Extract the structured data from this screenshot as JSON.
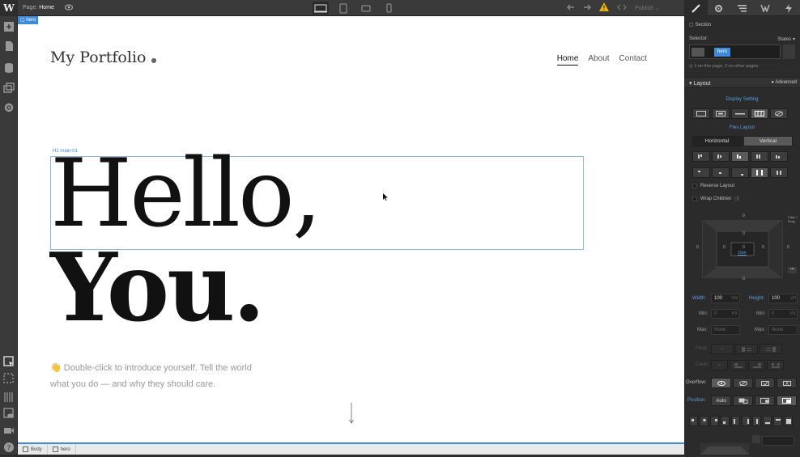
{
  "topbar": {
    "logo": "W",
    "page_label": "Page:",
    "page_name": "Home",
    "publish_label": "Publish"
  },
  "canvas": {
    "selection_tag": "hero",
    "brand": "My Portfolio",
    "brand_dot": "●",
    "nav": [
      "Home",
      "About",
      "Contact"
    ],
    "h1_tag_label": "H1  main-h1",
    "h1_line1": "Hello,",
    "h1_line2": "You.",
    "intro": "👋 Double-click to introduce yourself. Tell the world what you do — and why they should care."
  },
  "breadcrumb": [
    "Body",
    "hero"
  ],
  "right_panel": {
    "section_label": "Section",
    "selector_label": "Selector:",
    "states_label": "States",
    "selector_tag": "hero",
    "on_page_info": "1 on this page, 2 on other pages.",
    "layout_title": "Layout",
    "advanced_label": "Advanced",
    "display_setting_label": "Display Setting",
    "flex_layout_label": "Flex Layout",
    "direction_options": [
      "Horizontal",
      "Vertical"
    ],
    "direction_selected": "Vertical",
    "reverse_layout_label": "Reverse Layout",
    "wrap_children_label": "Wrap Children",
    "box_model": {
      "margin_top": "0",
      "margin_bottom": "0",
      "margin_left": "0",
      "margin_right": "0",
      "padding_top": "0",
      "padding_bottom": "10vh",
      "padding_left": "0",
      "padding_right": "0",
      "inner": "0"
    },
    "click_drag_hint": "Click + Drag",
    "width_label": "Width:",
    "width_value": "100",
    "width_unit": "VW",
    "height_label": "Height:",
    "height_value": "100",
    "height_unit": "VH",
    "min_label": "Min:",
    "min_w_value": "0",
    "min_h_value": "0",
    "min_unit": "PX",
    "max_label": "Max:",
    "max_w_value": "None",
    "max_h_value": "None",
    "float_label": "Float:",
    "clear_label": "Clear:",
    "overflow_label": "Overflow:",
    "position_label": "Position:",
    "position_auto": "Auto"
  },
  "colors": {
    "accent": "#3d8bd9",
    "panel_bg": "#2b2b2b",
    "warning": "#f0b400"
  }
}
